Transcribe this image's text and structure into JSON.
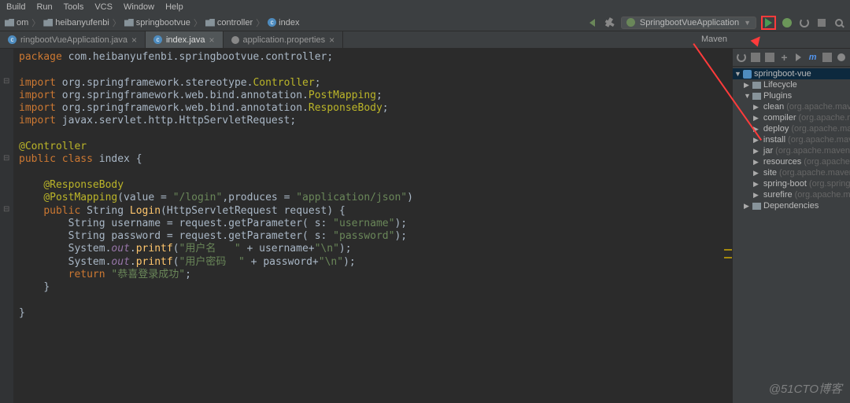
{
  "menu": {
    "items": [
      "Build",
      "Run",
      "Tools",
      "VCS",
      "Window",
      "Help"
    ]
  },
  "breadcrumbs": {
    "items": [
      {
        "icon": "folder",
        "label": "om"
      },
      {
        "icon": "folder",
        "label": "heibanyufenbi"
      },
      {
        "icon": "folder",
        "label": "springbootvue"
      },
      {
        "icon": "folder",
        "label": "controller"
      },
      {
        "icon": "class",
        "label": "index"
      }
    ]
  },
  "runConfig": {
    "label": "SpringbootVueApplication"
  },
  "tabs": [
    {
      "label": "ringbootVueApplication.java",
      "active": false,
      "icon": "class"
    },
    {
      "label": "index.java",
      "active": true,
      "icon": "class"
    },
    {
      "label": "application.properties",
      "active": false,
      "icon": "props"
    }
  ],
  "mavenHint": "Maven",
  "code": {
    "l1_a": "package ",
    "l1_b": "com.heibanyufenbi.springbootvue.controller",
    "l1_c": ";",
    "l3_a": "import ",
    "l3_b": "org.springframework.stereotype.",
    "l3_c": "Controller",
    "l3_d": ";",
    "l4_a": "import ",
    "l4_b": "org.springframework.web.bind.annotation.",
    "l4_c": "PostMapping",
    "l4_d": ";",
    "l5_a": "import ",
    "l5_b": "org.springframework.web.bind.annotation.",
    "l5_c": "ResponseBody",
    "l5_d": ";",
    "l6_a": "import ",
    "l6_b": "javax.servlet.http.HttpServletRequest",
    "l6_c": ";",
    "l8_a": "@Controller",
    "l9_a": "public class ",
    "l9_b": "index ",
    "l9_c": "{",
    "l11_a": "@ResponseBody",
    "l12_a": "@PostMapping",
    "l12_b": "(value = ",
    "l12_c": "\"/login\"",
    "l12_d": ",produces = ",
    "l12_e": "\"application/json\"",
    "l12_f": ")",
    "l13_a": "public ",
    "l13_b": "String ",
    "l13_c": "Login",
    "l13_d": "(HttpServletRequest request) {",
    "l14_a": "String username = request.getParameter( s: ",
    "l14_b": "\"username\"",
    "l14_c": ");",
    "l15_a": "String password = request.getParameter( s: ",
    "l15_b": "\"password\"",
    "l15_c": ");",
    "l16_a": "System.",
    "l16_b": "out",
    "l16_c": ".",
    "l16_d": "printf",
    "l16_e": "(",
    "l16_f": "\"用户名   \"",
    "l16_g": " + username+",
    "l16_h": "\"\\n\"",
    "l16_i": ");",
    "l17_a": "System.",
    "l17_b": "out",
    "l17_c": ".",
    "l17_d": "printf",
    "l17_e": "(",
    "l17_f": "\"用户密码  \"",
    "l17_g": " + password+",
    "l17_h": "\"\\n\"",
    "l17_i": ");",
    "l18_a": "return ",
    "l18_b": "\"恭喜登录成功\"",
    "l18_c": ";",
    "l19_a": "}",
    "l21_a": "}"
  },
  "mavenTree": {
    "root": "springboot-vue",
    "lifecycle": "Lifecycle",
    "plugins": "Plugins",
    "dependencies": "Dependencies",
    "pluginItems": [
      {
        "name": "clean",
        "hint": "(org.apache.maven"
      },
      {
        "name": "compiler",
        "hint": "(org.apache.ma"
      },
      {
        "name": "deploy",
        "hint": "(org.apache.mav"
      },
      {
        "name": "install",
        "hint": "(org.apache.mav"
      },
      {
        "name": "jar",
        "hint": "(org.apache.maven.p"
      },
      {
        "name": "resources",
        "hint": "(org.apache.m"
      },
      {
        "name": "site",
        "hint": "(org.apache.maven.p"
      },
      {
        "name": "spring-boot",
        "hint": "(org.springf"
      },
      {
        "name": "surefire",
        "hint": "(org.apache.ma"
      }
    ]
  },
  "watermark": "@51CTO博客"
}
